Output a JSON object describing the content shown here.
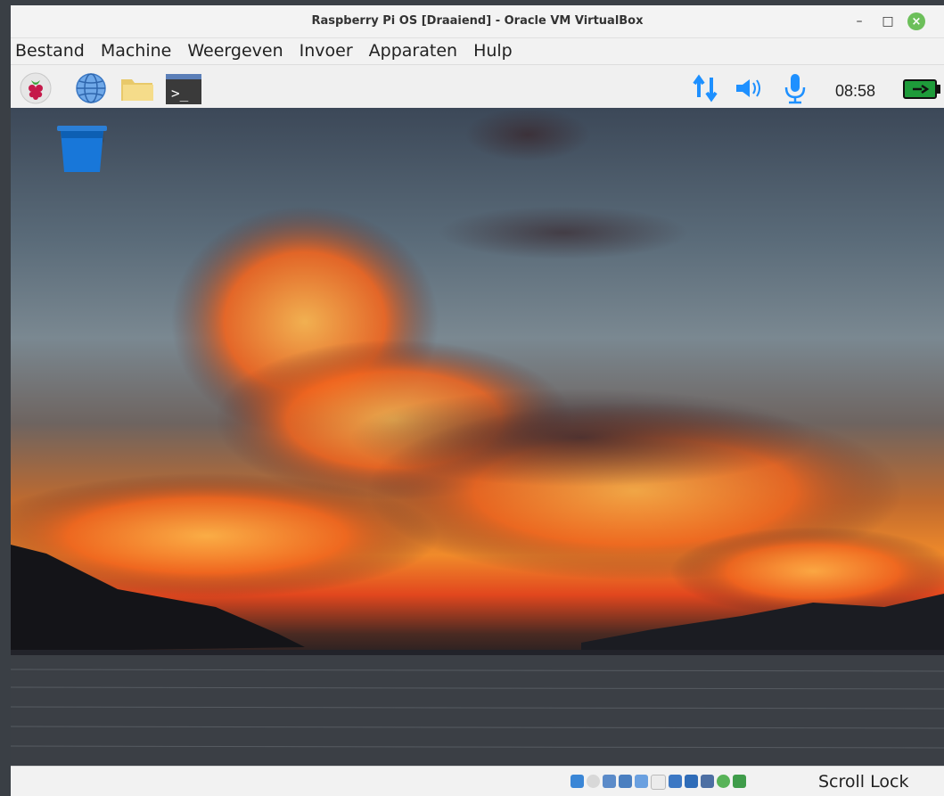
{
  "window": {
    "title": "Raspberry Pi OS [Draaiend] - Oracle VM VirtualBox",
    "minimize_label": "–",
    "maximize_label": "□",
    "close_label": "×"
  },
  "menubar": {
    "items": [
      "Bestand",
      "Machine",
      "Weergeven",
      "Invoer",
      "Apparaten",
      "Hulp"
    ]
  },
  "taskbar": {
    "launchers": [
      "raspberry-menu-icon",
      "web-browser-icon",
      "file-manager-icon",
      "terminal-icon"
    ],
    "tray_icons": [
      "network-icon",
      "volume-icon",
      "microphone-icon",
      "battery-icon"
    ],
    "clock": "08:58",
    "terminal_glyph": ">_"
  },
  "desktop": {
    "icons": [
      {
        "label": "Trash",
        "icon": "trash-icon"
      }
    ]
  },
  "statusbar": {
    "icons": [
      "hard-disk-icon",
      "optical-drive-icon",
      "audio-icon",
      "network-adapter-icon",
      "usb-icon",
      "shared-folders-icon",
      "display-icon",
      "recording-icon",
      "vm-state-icon",
      "mouse-integration-icon",
      "keyboard-icon"
    ],
    "indicator": "Scroll Lock"
  },
  "colors": {
    "accent_blue": "#1e90ff",
    "battery_green": "#22c55e",
    "close_button": "#6cbf5a"
  }
}
